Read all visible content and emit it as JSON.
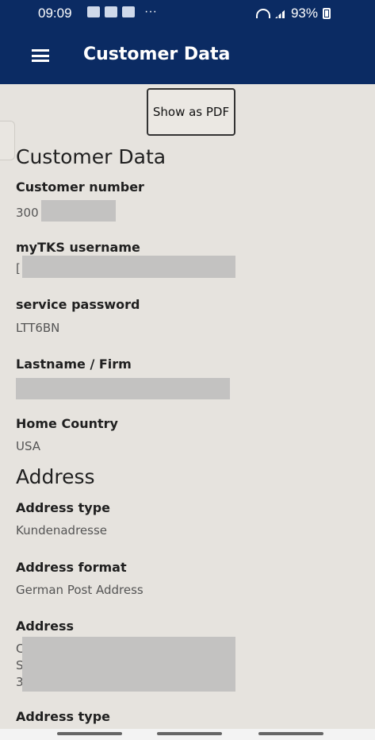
{
  "status_bar": {
    "time": "09:09",
    "dots": "···",
    "battery_percent": "93%"
  },
  "header": {
    "title": "Customer Data"
  },
  "toolbar": {
    "pdf_button": "Show as PDF"
  },
  "sections": {
    "customer_data": {
      "title": "Customer Data",
      "customer_number_label": "Customer number",
      "customer_number_value": "300",
      "mytks_username_label": "myTKS username",
      "mytks_username_value": "[",
      "service_password_label": "service password",
      "service_password_value": "LTT6BN",
      "lastname_label": "Lastname / Firm",
      "home_country_label": "Home Country",
      "home_country_value": "USA"
    },
    "address": {
      "title": "Address",
      "address_type_label": "Address type",
      "address_type_value": "Kundenadresse",
      "address_format_label": "Address format",
      "address_format_value": "German Post Address",
      "address_label": "Address",
      "address_line1": "C",
      "address_line2": "S",
      "address_line3": "3",
      "address_type_label_2": "Address type"
    }
  },
  "colors": {
    "app_bar": "#0b2b63",
    "background": "#e6e3de",
    "redaction": "#c3c2c1"
  }
}
